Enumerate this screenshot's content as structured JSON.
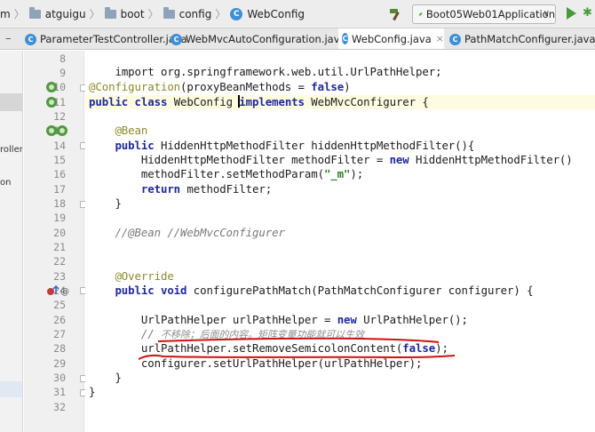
{
  "breadcrumb": {
    "items": [
      {
        "label": "m",
        "icon": "none"
      },
      {
        "label": "atguigu",
        "icon": "folder-icon"
      },
      {
        "label": "boot",
        "icon": "folder-icon"
      },
      {
        "label": "config",
        "icon": "folder-icon"
      },
      {
        "label": "WebConfig",
        "icon": "class-icon"
      }
    ]
  },
  "toolbar": {
    "run_config": "Boot05Web01Application",
    "build_icon": "hammer-icon",
    "run_icon": "run-icon",
    "debug_icon": "debug-icon"
  },
  "tabs": [
    {
      "label": "ParameterTestController.java",
      "active": false
    },
    {
      "label": "WebMvcAutoConfiguration.java",
      "active": false
    },
    {
      "label": "WebConfig.java",
      "active": true
    },
    {
      "label": "PathMatchConfigurer.java",
      "active": false
    }
  ],
  "sidebar": {
    "fragments": [
      "roller",
      "on"
    ]
  },
  "editor": {
    "line_numbers": [
      "8",
      "9",
      "10",
      "11",
      "12",
      "13",
      "14",
      "15",
      "16",
      "17",
      "18",
      "19",
      "20",
      "21",
      "22",
      "23",
      "24",
      "25",
      "26",
      "27",
      "28",
      "29",
      "30",
      "31",
      "32"
    ],
    "lines": {
      "l8": "import org.springframework.web.util.UrlPathHelper;",
      "l10a": "@Configuration",
      "l10b": "(proxyBeanMethods = ",
      "l10c": "false",
      "l10d": ")",
      "l11a": "public class ",
      "l11b": "WebConfig ",
      "l11c": "implements",
      "l11d": " WebMvcConfigurer {",
      "l13": "    @Bean",
      "l14a": "    public ",
      "l14b": "HiddenHttpMethodFilter hiddenHttpMethodFilter(){",
      "l15a": "        HiddenHttpMethodFilter methodFilter = ",
      "l15b": "new",
      "l15c": " HiddenHttpMethodFilter()",
      "l16a": "        methodFilter.setMethodParam(",
      "l16b": "\"_m\"",
      "l16c": ");",
      "l17a": "        return",
      "l17b": " methodFilter;",
      "l18": "    }",
      "l20": "    //@Bean //WebMvcConfigurer",
      "l23": "    @Override",
      "l24a": "    public void ",
      "l24b": "configurePathMatch(PathMatchConfigurer configurer) {",
      "l26a": "        UrlPathHelper urlPathHelper = ",
      "l26b": "new",
      "l26c": " UrlPathHelper();",
      "l27a": "        // ",
      "l27b": "不移除；后面的内容。矩阵变量功能就可以生效",
      "l28a": "        urlPathHelper.setRemoveSemicolonContent(",
      "l28b": "false",
      "l28c": ");",
      "l29": "        configurer.setUrlPathHelper(urlPathHelper);",
      "l30": "    }",
      "l31": "}"
    }
  },
  "colors": {
    "keyword": "#1f2a9a",
    "annotation": "#8a8a2a",
    "string": "#2a7d2a",
    "comment": "#7a7a7a",
    "underline": "#d01010"
  }
}
